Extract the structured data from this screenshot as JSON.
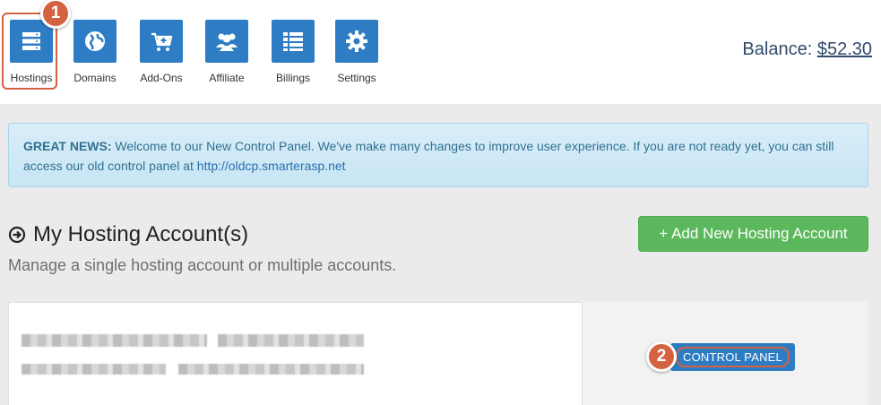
{
  "nav": {
    "items": [
      {
        "label": "Hostings",
        "icon": "server-icon"
      },
      {
        "label": "Domains",
        "icon": "globe-icon"
      },
      {
        "label": "Add-Ons",
        "icon": "cart-plus-icon"
      },
      {
        "label": "Affiliate",
        "icon": "users-icon"
      },
      {
        "label": "Billings",
        "icon": "list-icon"
      },
      {
        "label": "Settings",
        "icon": "gear-icon"
      }
    ]
  },
  "balance": {
    "label": "Balance:",
    "amount": "$52.30"
  },
  "steps": {
    "one": "1",
    "two": "2"
  },
  "alert": {
    "title": "GREAT NEWS:",
    "text": "Welcome to our New Control Panel. We've make many changes to improve user experience. If you are not ready yet, you can still access our old control panel at",
    "link": "http://oldcp.smarterasp.net"
  },
  "section": {
    "title": "My Hosting Account(s)",
    "subtitle": "Manage a single hosting account or multiple accounts."
  },
  "add_button": "+ Add New Hosting Account",
  "account": {
    "control_panel_label": "CONTROL PANEL"
  },
  "colors": {
    "primary": "#2e7dc4",
    "success": "#5cb85c",
    "highlight": "#d4613f"
  }
}
